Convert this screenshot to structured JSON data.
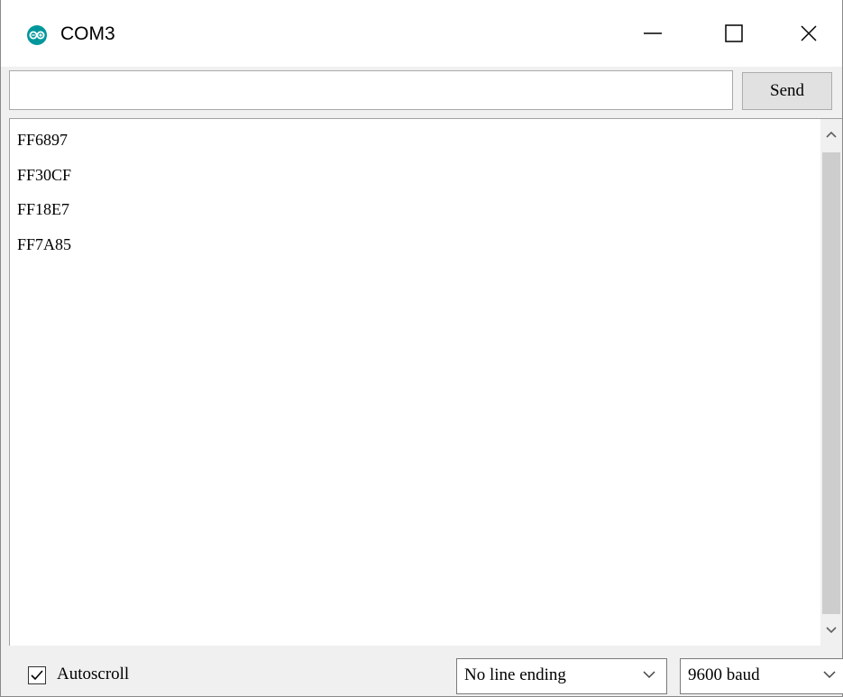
{
  "window": {
    "title": "COM3",
    "icons": {
      "app": "arduino-logo-icon",
      "minimize": "minimize-icon",
      "maximize": "maximize-icon",
      "close": "close-icon"
    }
  },
  "send": {
    "input_value": "",
    "button_label": "Send"
  },
  "output": {
    "lines": [
      "FF6897",
      "FF30CF",
      "FF18E7",
      "FF7A85"
    ]
  },
  "footer": {
    "autoscroll_label": "Autoscroll",
    "autoscroll_checked": true,
    "line_ending_selected": "No line ending",
    "baud_selected": "9600 baud"
  },
  "colors": {
    "brand": "#00979c",
    "chrome": "#f0f0f0",
    "scroll_thumb": "#cdcdcd"
  }
}
